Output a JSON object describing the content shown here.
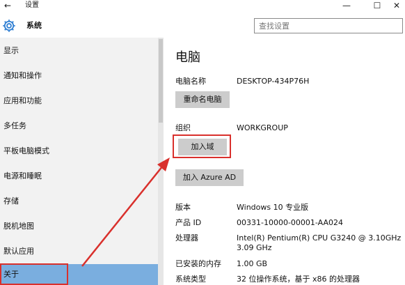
{
  "window": {
    "title": "设置",
    "back_glyph": "←",
    "minimize_glyph": "—",
    "maximize_glyph": "☐",
    "close_glyph": "✕"
  },
  "header": {
    "section_title": "系统",
    "search_placeholder": "查找设置",
    "icon": "gear-icon"
  },
  "sidebar": {
    "items": [
      {
        "label": "显示",
        "active": false
      },
      {
        "label": "通知和操作",
        "active": false
      },
      {
        "label": "应用和功能",
        "active": false
      },
      {
        "label": "多任务",
        "active": false
      },
      {
        "label": "平板电脑模式",
        "active": false
      },
      {
        "label": "电源和睡眠",
        "active": false
      },
      {
        "label": "存储",
        "active": false
      },
      {
        "label": "脱机地图",
        "active": false
      },
      {
        "label": "默认应用",
        "active": false
      },
      {
        "label": "关于",
        "active": true
      }
    ]
  },
  "content": {
    "page_title": "电脑",
    "pc_name_label": "电脑名称",
    "pc_name_value": "DESKTOP-434P76H",
    "rename_button": "重命名电脑",
    "org_label": "组织",
    "org_value": "WORKGROUP",
    "join_domain_button": "加入域",
    "join_azure_button": "加入 Azure AD",
    "specs": [
      {
        "label": "版本",
        "value": "Windows 10 专业版"
      },
      {
        "label": "产品 ID",
        "value": "00331-10000-00001-AA024"
      },
      {
        "label": "处理器",
        "value": "Intel(R) Pentium(R) CPU G3240 @ 3.10GHz",
        "value2": "3.09 GHz"
      },
      {
        "label": "已安装的内存",
        "value": "1.00 GB"
      },
      {
        "label": "系统类型",
        "value": "32 位操作系统，基于 x86 的处理器"
      }
    ]
  },
  "colors": {
    "accent_selected": "#7aaedf",
    "annotation_red": "#d9302c",
    "button_gray": "#cccccc",
    "sidebar_bg": "#f2f2f2"
  }
}
